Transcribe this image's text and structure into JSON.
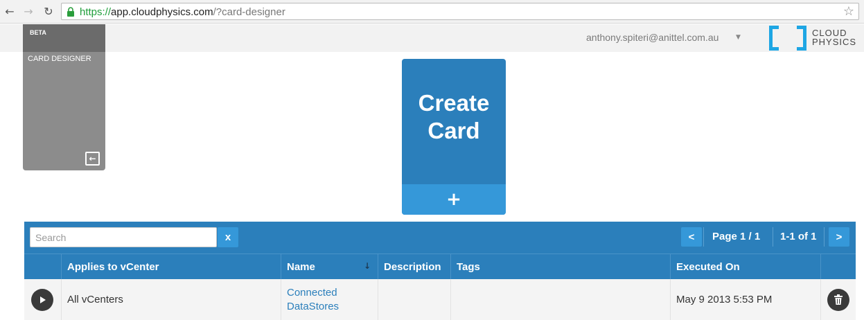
{
  "browser": {
    "url_scheme": "https://",
    "url_host": "app.cloudphysics.com",
    "url_path": "/?card-designer",
    "back_icon": "←",
    "forward_icon": "→",
    "reload_icon": "↻",
    "star_icon": "☆"
  },
  "header": {
    "user_email": "anthony.spiteri@anittel.com.au",
    "user_caret": "▼",
    "logo_line1": "CLOUD",
    "logo_line2": "PHYSICS",
    "brand_color": "#1ea6e4"
  },
  "sidebar": {
    "badge": "BETA",
    "item_label": "CARD DESIGNER",
    "collapse_icon": "←"
  },
  "create_card": {
    "title_line1": "Create",
    "title_line2": "Card",
    "plus_label": "+"
  },
  "toolbar": {
    "search_placeholder": "Search",
    "clear_label": "x",
    "prev_label": "<",
    "page_label": "Page 1 / 1",
    "range_label": "1-1 of 1",
    "next_label": ">"
  },
  "table": {
    "columns": [
      "",
      "Applies to vCenter",
      "Name",
      "Description",
      "Tags",
      "Executed On",
      ""
    ],
    "sort_icon": "↓",
    "rows": [
      {
        "applies_to": "All vCenters",
        "name_line1": "Connected",
        "name_line2": "DataStores",
        "description": "",
        "tags": "",
        "executed_on": "May 9 2013 5:53 PM"
      }
    ]
  },
  "colors": {
    "primary": "#2b7fbb",
    "primary_light": "#3598d9",
    "sidebar": "#8c8c8c"
  }
}
